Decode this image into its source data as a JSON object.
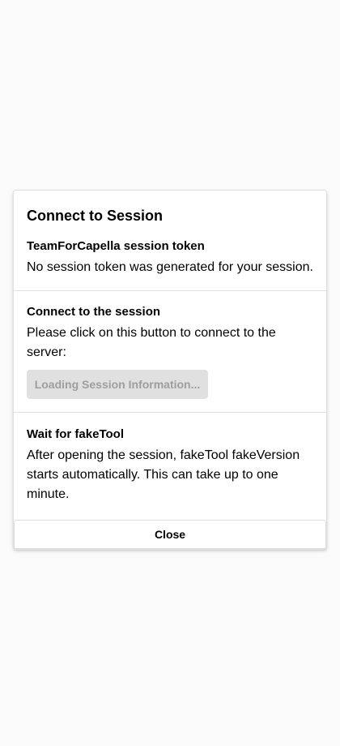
{
  "dialog": {
    "title": "Connect to Session",
    "token_section": {
      "heading": "TeamForCapella session token",
      "text": "No session token was generated for your session."
    },
    "connect_section": {
      "heading": "Connect to the session",
      "text": "Please click on this button to connect to the server:",
      "button_label": "Loading Session Information..."
    },
    "wait_section": {
      "heading": "Wait for fakeTool",
      "text": "After opening the session, fakeTool fakeVersion starts automatically. This can take up to one minute."
    },
    "close_label": "Close"
  }
}
